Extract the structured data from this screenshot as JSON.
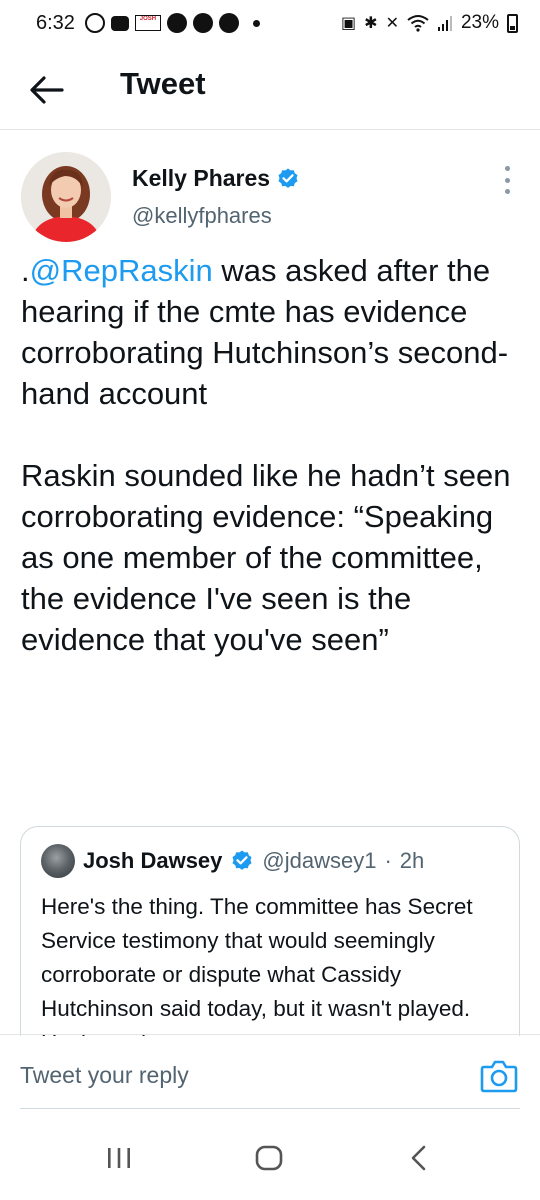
{
  "status_bar": {
    "time": "6:32",
    "battery": "23%",
    "news_icon_text": "JOSH"
  },
  "header": {
    "title": "Tweet"
  },
  "tweet": {
    "author_name": "Kelly Phares",
    "author_handle": "@kellyfphares",
    "mention": "@RepRaskin",
    "paragraph1_prefix": ".",
    "paragraph1_rest": " was asked after the hearing if the cmte has evidence corroborating Hutchinson’s second-hand account",
    "paragraph2": "Raskin sounded like he hadn’t seen corroborating evidence: “Speaking as one member of the committee, the evidence I've seen is the evidence that you've seen”"
  },
  "quoted_tweet": {
    "author_name": "Josh Dawsey",
    "author_handle": "@jdawsey1",
    "separator": "·",
    "time": "2h",
    "text": "Here's the thing. The committee has Secret Service testimony that would seemingly corroborate or dispute what Cassidy Hutchinson said today, but it wasn't played. Unclear why."
  },
  "reply": {
    "placeholder": "Tweet your reply"
  },
  "colors": {
    "accent": "#1d9bf0",
    "text": "#0f1419",
    "secondary": "#536471"
  },
  "icons": [
    "back-arrow-icon",
    "verified-badge-icon",
    "more-options-icon",
    "camera-icon",
    "recent-apps-icon",
    "home-icon",
    "nav-back-icon"
  ]
}
